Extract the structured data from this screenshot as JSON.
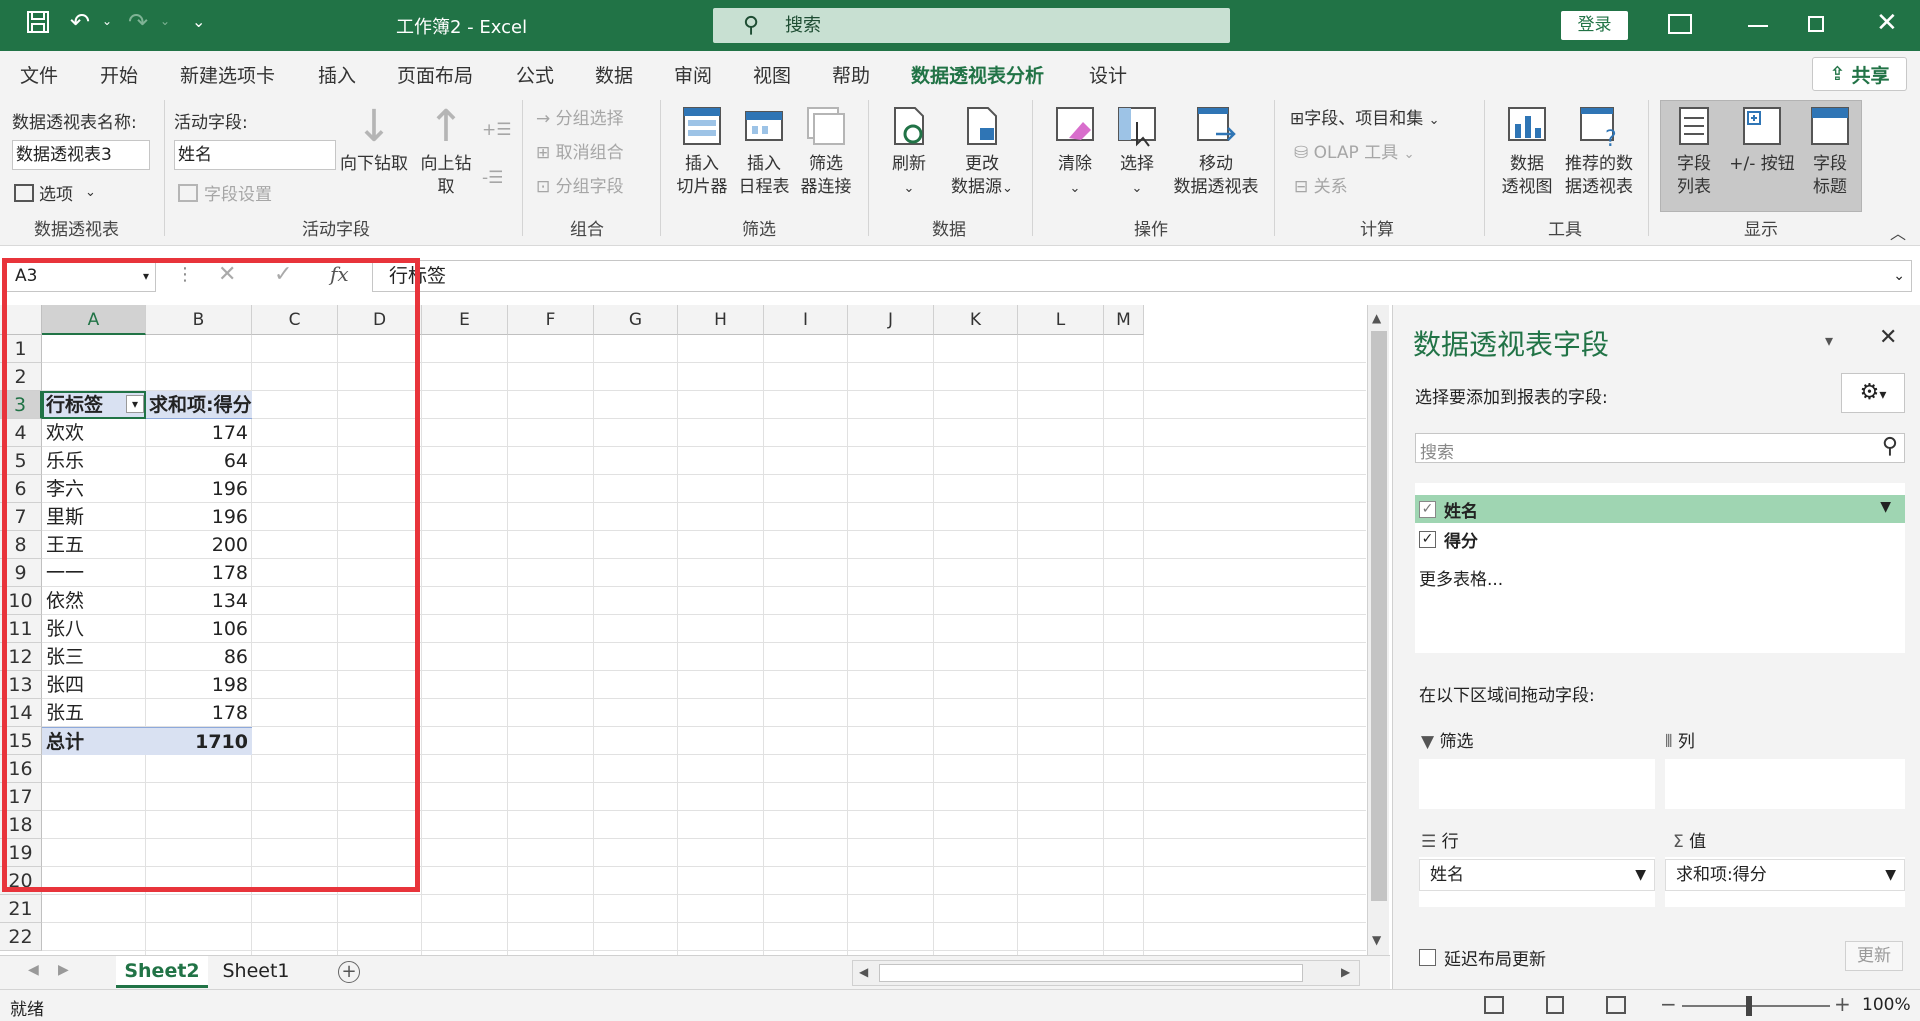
{
  "titlebar": {
    "doc_title": "工作簿2  -  Excel",
    "search_placeholder": "搜索",
    "login_label": "登录"
  },
  "tabs": [
    "文件",
    "开始",
    "新建选项卡",
    "插入",
    "页面布局",
    "公式",
    "数据",
    "审阅",
    "视图",
    "帮助",
    "数据透视表分析",
    "设计"
  ],
  "share_label": "共享",
  "ribbon": {
    "pivot_name_label": "数据透视表名称:",
    "pivot_name_value": "数据透视表3",
    "options_label": "选项",
    "group_pivot": "数据透视表",
    "active_field_label": "活动字段:",
    "active_field_value": "姓名",
    "field_settings": "字段设置",
    "drill_down": "向下钻取",
    "drill_up_1": "向上钻",
    "drill_up_2": "取",
    "group_active_field": "活动字段",
    "group_selection": "分组选择",
    "ungroup": "取消组合",
    "group_field": "分组字段",
    "group_group": "组合",
    "insert_slicer_1": "插入",
    "insert_slicer_2": "切片器",
    "insert_timeline_1": "插入",
    "insert_timeline_2": "日程表",
    "filter_conn_1": "筛选",
    "filter_conn_2": "器连接",
    "group_filter": "筛选",
    "refresh": "刷新",
    "change_source_1": "更改",
    "change_source_2": "数据源",
    "group_data": "数据",
    "clear": "清除",
    "select": "选择",
    "move_1": "移动",
    "move_2": "数据透视表",
    "group_actions": "操作",
    "fields_items": "字段、项目和集",
    "olap": "OLAP 工具",
    "relations": "关系",
    "group_calc": "计算",
    "pivot_chart_1": "数据",
    "pivot_chart_2": "透视图",
    "recommended_1": "推荐的数",
    "recommended_2": "据透视表",
    "group_tools": "工具",
    "field_list_1": "字段",
    "field_list_2": "列表",
    "buttons": "+/- 按钮",
    "field_headers_1": "字段",
    "field_headers_2": "标题",
    "group_show": "显示"
  },
  "formula_bar": {
    "name_box": "A3",
    "formula": "行标签",
    "fx": "fx"
  },
  "columns": [
    "A",
    "B",
    "C",
    "D",
    "E",
    "F",
    "G",
    "H",
    "I",
    "J",
    "K",
    "L",
    "M"
  ],
  "rows": [
    "1",
    "2",
    "3",
    "4",
    "5",
    "6",
    "7",
    "8",
    "9",
    "10",
    "11",
    "12",
    "13",
    "14",
    "15",
    "16",
    "17",
    "18",
    "19",
    "20",
    "21",
    "22"
  ],
  "pivot": {
    "header_row_label": "行标签",
    "header_sum": "求和项:得分",
    "items": [
      {
        "name": "欢欢",
        "value": "174"
      },
      {
        "name": "乐乐",
        "value": "64"
      },
      {
        "name": "李六",
        "value": "196"
      },
      {
        "name": "里斯",
        "value": "196"
      },
      {
        "name": "王五",
        "value": "200"
      },
      {
        "name": "一一",
        "value": "178"
      },
      {
        "name": "依然",
        "value": "134"
      },
      {
        "name": "张八",
        "value": "106"
      },
      {
        "name": "张三",
        "value": "86"
      },
      {
        "name": "张四",
        "value": "198"
      },
      {
        "name": "张五",
        "value": "178"
      }
    ],
    "total_label": "总计",
    "total_value": "1710"
  },
  "sheets": [
    "Sheet2",
    "Sheet1"
  ],
  "status": {
    "ready": "就绪",
    "zoom": "100%"
  },
  "pane": {
    "title": "数据透视表字段",
    "choose_fields": "选择要添加到报表的字段:",
    "search_placeholder": "搜索",
    "fields": [
      {
        "name": "姓名",
        "checked": true
      },
      {
        "name": "得分",
        "checked": true
      }
    ],
    "more_tables": "更多表格...",
    "drag_hint": "在以下区域间拖动字段:",
    "area_filter": "筛选",
    "area_columns": "列",
    "area_rows": "行",
    "area_values": "值",
    "rows_item": "姓名",
    "values_item": "求和项:得分",
    "defer_update": "延迟布局更新",
    "update_btn": "更新"
  },
  "colors": {
    "excel_green": "#217346",
    "pivot_header_fill": "#d9e1f2",
    "highlight_red": "#e8343b"
  }
}
